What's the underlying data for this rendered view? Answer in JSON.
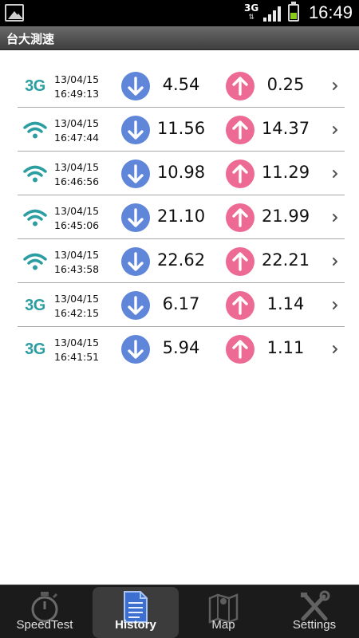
{
  "status_bar": {
    "network": "3G",
    "time": "16:49",
    "battery_level": 0.45
  },
  "app": {
    "title": "台大測速"
  },
  "colors": {
    "download_circle": "#5f86d9",
    "upload_circle": "#ec6a94",
    "network_icon": "#2c9ea1"
  },
  "history": [
    {
      "network": "3G",
      "date": "13/04/15",
      "time": "16:49:13",
      "download": "4.54",
      "upload": "0.25"
    },
    {
      "network": "wifi",
      "date": "13/04/15",
      "time": "16:47:44",
      "download": "11.56",
      "upload": "14.37"
    },
    {
      "network": "wifi",
      "date": "13/04/15",
      "time": "16:46:56",
      "download": "10.98",
      "upload": "11.29"
    },
    {
      "network": "wifi",
      "date": "13/04/15",
      "time": "16:45:06",
      "download": "21.10",
      "upload": "21.99"
    },
    {
      "network": "wifi",
      "date": "13/04/15",
      "time": "16:43:58",
      "download": "22.62",
      "upload": "22.21"
    },
    {
      "network": "3G",
      "date": "13/04/15",
      "time": "16:42:15",
      "download": "6.17",
      "upload": "1.14"
    },
    {
      "network": "3G",
      "date": "13/04/15",
      "time": "16:41:51",
      "download": "5.94",
      "upload": "1.11"
    }
  ],
  "nav": {
    "tabs": [
      {
        "label": "SpeedTest",
        "icon": "stopwatch-icon",
        "selected": false
      },
      {
        "label": "History",
        "icon": "document-icon",
        "selected": true
      },
      {
        "label": "Map",
        "icon": "map-icon",
        "selected": false
      },
      {
        "label": "Settings",
        "icon": "tools-icon",
        "selected": false
      }
    ]
  }
}
